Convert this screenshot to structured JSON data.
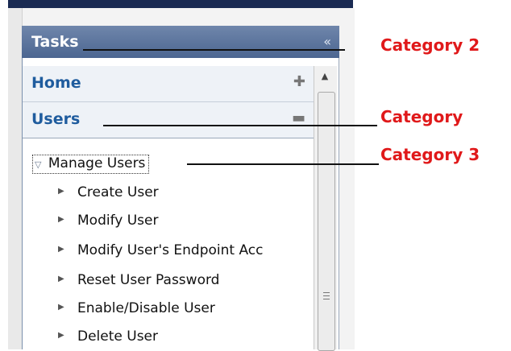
{
  "panel": {
    "title": "Tasks",
    "collapse_icon": "«",
    "categories": [
      {
        "label": "Home",
        "icon": "✚",
        "icon_name": "expand-plus-icon"
      },
      {
        "label": "Users",
        "icon": "▬",
        "icon_name": "collapse-minus-icon"
      }
    ],
    "group": {
      "label": "Manage Users",
      "icon": "▽"
    },
    "items": [
      "Create User",
      "Modify User",
      "Modify User's Endpoint Acc",
      "Reset User Password",
      "Enable/Disable User",
      "Delete User"
    ],
    "scrollbar": {
      "up_arrow": "▲"
    }
  },
  "annotations": {
    "category2": "Category 2",
    "category": "Category",
    "category3": "Category 3"
  },
  "colors": {
    "header": "#4c6691",
    "category_text": "#1f5c9e",
    "annotation": "#e0191a"
  }
}
